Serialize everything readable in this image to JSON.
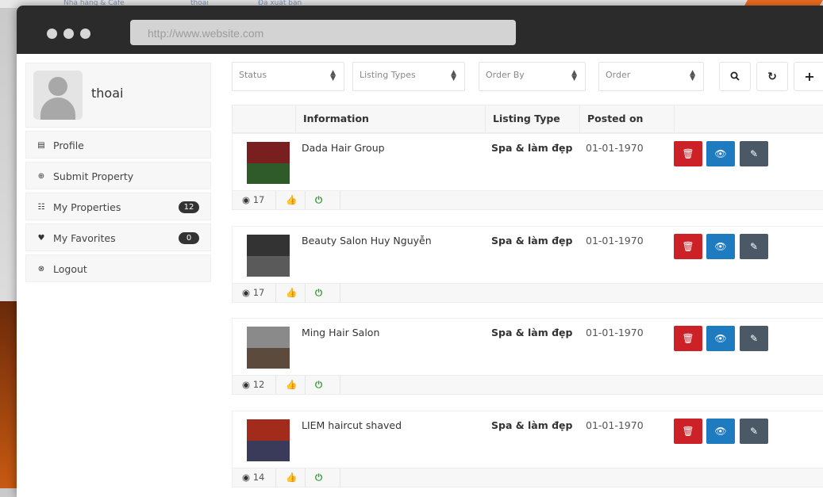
{
  "background": {
    "strip": [
      "Nhà hàng & Cafe",
      "thoai",
      "Đã xuất bản"
    ]
  },
  "browser": {
    "url": "http://www.website.com"
  },
  "sidebar": {
    "username": "thoai",
    "items": [
      {
        "label": "Profile",
        "icon": "list-alt-icon",
        "badge": null
      },
      {
        "label": "Submit Property",
        "icon": "plus-circle-icon",
        "badge": null
      },
      {
        "label": "My Properties",
        "icon": "th-list-icon",
        "badge": "12"
      },
      {
        "label": "My Favorites",
        "icon": "heart-icon",
        "badge": "0"
      },
      {
        "label": "Logout",
        "icon": "times-circle-icon",
        "badge": null
      }
    ]
  },
  "filters": {
    "status": "Status",
    "listing_types": "Listing Types",
    "order_by": "Order By",
    "order": "Order"
  },
  "table": {
    "headers": [
      "Information",
      "Listing Type",
      "Posted on"
    ]
  },
  "listings": [
    {
      "name": "Dada Hair Group",
      "type": "Spa & làm đẹp",
      "posted": "01-01-1970",
      "views": "17",
      "colors": [
        "#7a1f1f",
        "#2f5a2a"
      ]
    },
    {
      "name": "Beauty Salon Huy Nguyễn",
      "type": "Spa & làm đẹp",
      "posted": "01-01-1970",
      "views": "17",
      "colors": [
        "#333333",
        "#5a5a5a"
      ]
    },
    {
      "name": "Ming Hair Salon",
      "type": "Spa & làm đẹp",
      "posted": "01-01-1970",
      "views": "12",
      "colors": [
        "#8a8a8a",
        "#5c4a3d"
      ]
    },
    {
      "name": "LIEM haircut shaved",
      "type": "Spa & làm đẹp",
      "posted": "01-01-1970",
      "views": "14",
      "colors": [
        "#a22b1c",
        "#3a3a5a"
      ]
    }
  ],
  "colors": {
    "delete": "#cc2127",
    "view": "#1f7bc0",
    "edit": "#4a5965",
    "like": "#1f7bc0",
    "status_active": "#2e9c2e"
  }
}
